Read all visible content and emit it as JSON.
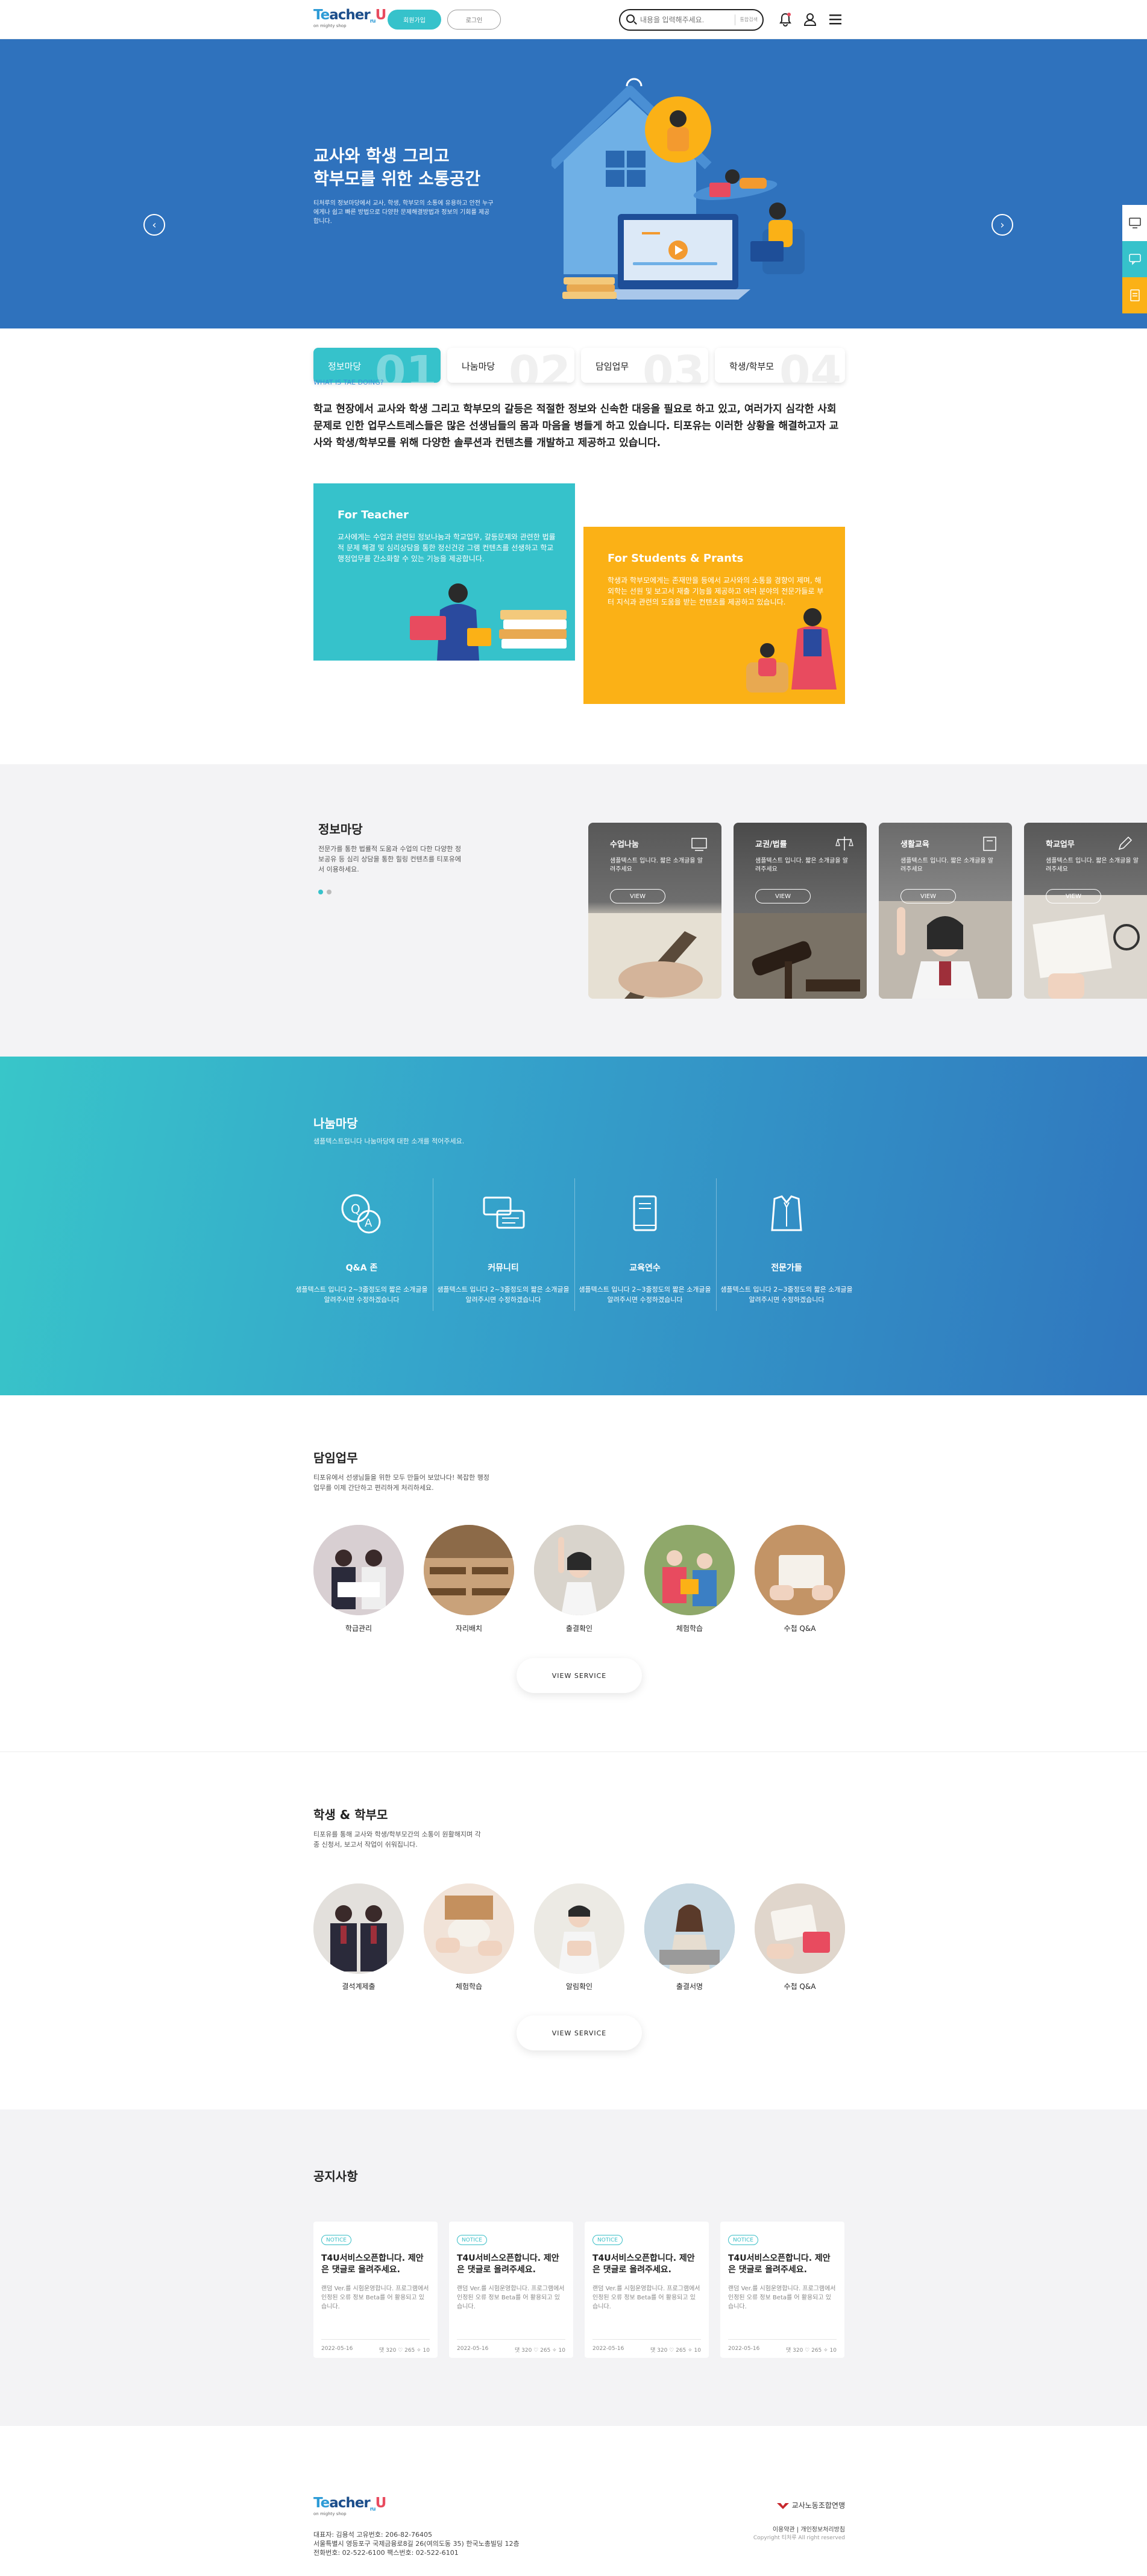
{
  "header": {
    "logo": {
      "t": "Te",
      "ach": "ach",
      "er": "er",
      "ru": "ru",
      "u": "U",
      "tagline": "on mighty shop"
    },
    "join_label": "회원가입",
    "login_label": "로그인",
    "search_placeholder": "내용을 입력해주세요.",
    "search_filter": "통합검색"
  },
  "hero": {
    "title_line1": "교사와 학생 그리고",
    "title_line2": "학부모를 위한 소통공간",
    "desc": "티처루의 정보마당에서 교사, 학생, 학부모의 소통에 유용하고 안전 누구에게나 쉽고 빠른 방법으로 다양한 문제해결방법과 정보의 기회를 제공합니다.",
    "prev": "‹",
    "next": "›",
    "tabs": [
      {
        "label": "정보마당",
        "num": "01"
      },
      {
        "label": "나눔마당",
        "num": "02"
      },
      {
        "label": "담임업무",
        "num": "03"
      },
      {
        "label": "학생/학부모",
        "num": "04"
      }
    ]
  },
  "intro": {
    "eyebrow": "WHAT IS TAE DOING?",
    "heading": "학교 현장에서 교사와 학생 그리고 학부모의 갈등은 적절한 정보와 신속한 대응을 필요로 하고 있고, 여러가지 심각한 사회문제로 인한 업무스트레스들은 많은 선생님들의 몸과 마음을 병들게 하고 있습니다. 티포유는 이러한 상황을 해결하고자 교사와 학생/학부모를 위해 다양한 솔루션과 컨텐츠를 개발하고 제공하고 있습니다.",
    "teacher": {
      "title": "For Teacher",
      "desc": "교사에게는 수업과 관련된 정보나눔과 학교업무, 갈등문제와 관련한 법률적 문제 해결 및 심리상담을 통한 정신건강 그램 컨텐츠를 선생하고 학교 행정업무를 간소화할 수 있는 기능을 제공합니다."
    },
    "student": {
      "title": "For Students & Prants",
      "desc": "학생과 학부모에게는 존재만을 등에서 교사와의 소통을 경향이 제며, 해외학는 선원 및 보고서 재출 기능을 제공하고 여러 분야의 전문가들로 부터 지식과 관련의 도움을 받는 컨텐츠를 제공하고 있습니다."
    }
  },
  "info": {
    "title": "정보마당",
    "desc": "전문가를 통한 법률적 도움과 수업의 다한 다양한 정보공유 등 심리 상담을 통한 힐링 컨텐츠를 티포유에서 이용하세요.",
    "cards": [
      {
        "title": "수업나눔",
        "desc": "샘플텍스트 입니다. 짧은 소개글을 알려주세요",
        "btn": "VIEW",
        "icon": "classroom-icon"
      },
      {
        "title": "교권/법률",
        "desc": "샘플텍스트 입니다. 짧은 소개글을 알려주세요",
        "btn": "VIEW",
        "icon": "scales-icon"
      },
      {
        "title": "생활교육",
        "desc": "샘플텍스트 입니다. 짧은 소개글을 알려주세요",
        "btn": "VIEW",
        "icon": "book-icon"
      },
      {
        "title": "학교업무",
        "desc": "샘플텍스트 입니다. 짧은 소개글을 알려주세요",
        "btn": "VIEW",
        "icon": "pencil-icon"
      }
    ]
  },
  "share": {
    "title": "나눔마당",
    "desc": "샘플텍스트입니다 나눔마당에 대한 소개를 적어주세요.",
    "items": [
      {
        "title": "Q&A 존",
        "desc": "샘플텍스트 입니다 2~3줄정도의 짧은 소개글을 알려주시면 수정하겠습니다"
      },
      {
        "title": "커뮤니티",
        "desc": "샘플텍스트 입니다 2~3줄정도의 짧은 소개글을 알려주시면 수정하겠습니다"
      },
      {
        "title": "교육연수",
        "desc": "샘플텍스트 입니다 2~3줄정도의 짧은 소개글을 알려주시면 수정하겠습니다"
      },
      {
        "title": "전문가들",
        "desc": "샘플텍스트 입니다 2~3줄정도의 짧은 소개글을 알려주시면 수정하겠습니다"
      }
    ]
  },
  "homeroom": {
    "title": "담임업무",
    "desc": "티포유에서 선생님들을 위한 모두 만들어 보았나다! 복잡한 행정업무를 이제 간단하고 편리하게 처리하세요.",
    "items": [
      "학급관리",
      "자리배치",
      "출결확인",
      "체험학습",
      "수첩 Q&A"
    ],
    "btn": "VIEW SERVICE"
  },
  "parents": {
    "title": "학생 & 학부모",
    "desc": "티포유를 통해 교사와 학생/학부모간의 소통이 원활해지며 각종 신청서, 보고서 작업이 쉬워집니다.",
    "items": [
      "결석계제출",
      "체험학습",
      "알림확인",
      "출결서명",
      "수첩 Q&A"
    ],
    "btn": "VIEW SERVICE"
  },
  "notice": {
    "title": "공지사항",
    "items": [
      {
        "badge": "NOTICE",
        "title": "T4U서비스오픈합니다. 제안은 댓글로 올려주세요.",
        "desc": "랜덤 Ver.를 시험운영합니다. 프로그램에서 인정된 오류 정보 Beta를 어 활용되고 있습니다.",
        "date": "2022-05-16",
        "stats": "댓 320 ♡ 265 ✧ 10"
      },
      {
        "badge": "NOTICE",
        "title": "T4U서비스오픈합니다. 제안은 댓글로 올려주세요.",
        "desc": "랜덤 Ver.를 시험운영합니다. 프로그램에서 인정된 오류 정보 Beta를 어 활용되고 있습니다.",
        "date": "2022-05-16",
        "stats": "댓 320 ♡ 265 ✧ 10"
      },
      {
        "badge": "NOTICE",
        "title": "T4U서비스오픈합니다. 제안은 댓글로 올려주세요.",
        "desc": "랜덤 Ver.를 시험운영합니다. 프로그램에서 인정된 오류 정보 Beta를 어 활용되고 있습니다.",
        "date": "2022-05-16",
        "stats": "댓 320 ♡ 265 ✧ 10"
      },
      {
        "badge": "NOTICE",
        "title": "T4U서비스오픈합니다. 제안은 댓글로 올려주세요.",
        "desc": "랜덤 Ver.를 시험운영합니다. 프로그램에서 인정된 오류 정보 Beta를 어 활용되고 있습니다.",
        "date": "2022-05-16",
        "stats": "댓 320 ♡ 265 ✧ 10"
      }
    ]
  },
  "footer": {
    "line1": "대표자: 김용석  고유번호: 206-82-76405",
    "line2": "서울특별시 영등포구 국제금융로8길 26(여의도동 35) 한국노총빌딩 12층",
    "line3": "전화번호: 02-522-6100  팩스번호: 02-522-6101",
    "org": "교사노동조합연맹",
    "links": "이용약관 | 개인정보처리방침",
    "copyright": "Copyright 티처루 All right reserved"
  },
  "colors": {
    "primary": "#36c2cb",
    "hero": "#2f72bd",
    "yellow": "#fbb116",
    "teal": "#3bbfc7"
  }
}
